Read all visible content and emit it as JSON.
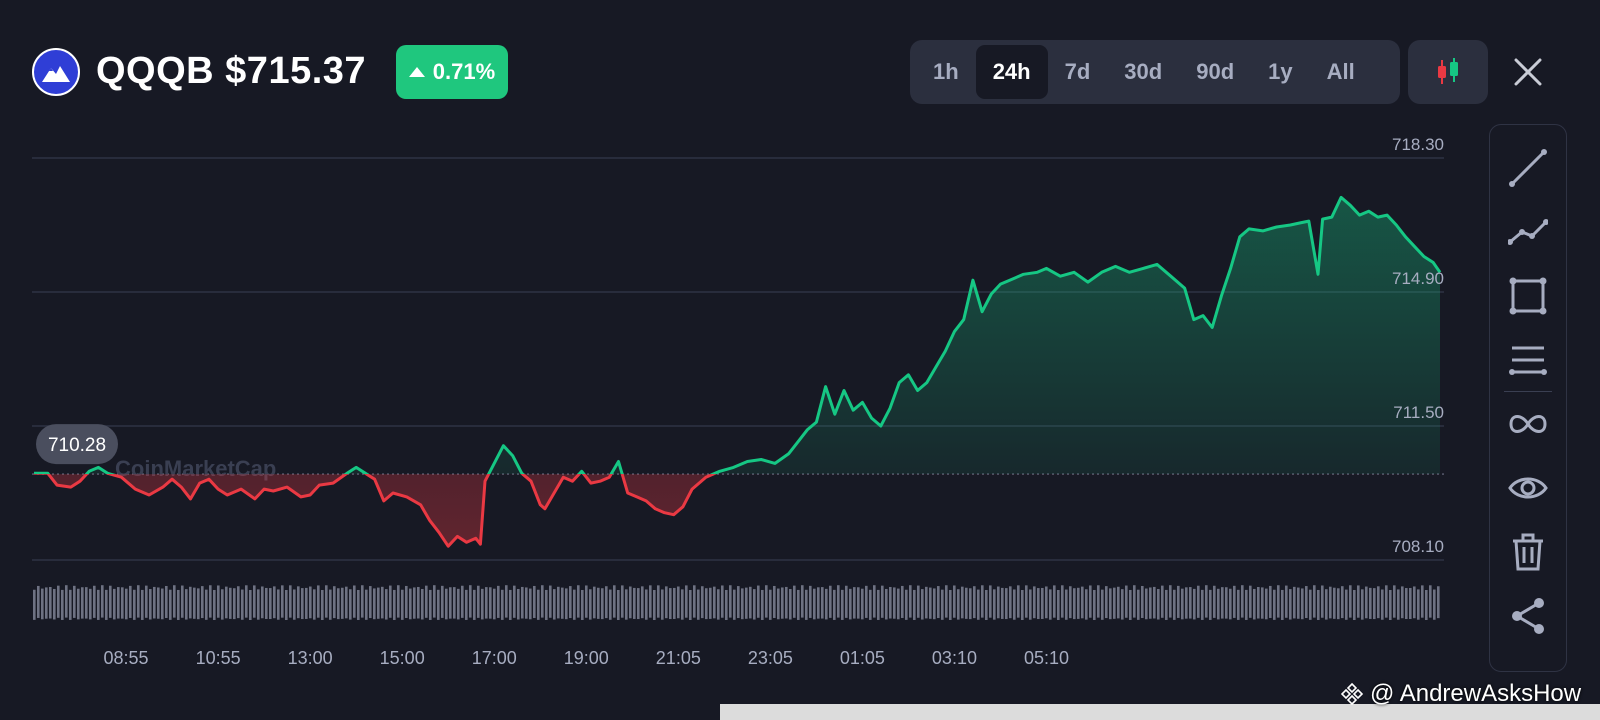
{
  "header": {
    "title": "QQQB $715.37",
    "change": "0.71%",
    "change_direction": "up",
    "logo_icon": "mountain-logo-icon"
  },
  "timeframes": {
    "items": [
      "1h",
      "24h",
      "7d",
      "30d",
      "90d",
      "1y",
      "All"
    ],
    "active": "24h"
  },
  "toolbar": {
    "chart_type_icon": "candlestick-icon",
    "close_icon": "close-icon",
    "tools": [
      "trend-line-icon",
      "path-icon",
      "rectangle-icon",
      "fibonacci-icon",
      "infinite-line-icon",
      "eye-icon",
      "trash-icon",
      "share-icon"
    ]
  },
  "watermark": "CoinMarketCap",
  "credit": "@ AndrewAsksHow",
  "colors": {
    "up": "#16c784",
    "down": "#ea3943",
    "background": "#171924",
    "badge": "#1fc77e"
  },
  "chart_data": {
    "type": "line",
    "title": "",
    "xlabel": "",
    "ylabel": "",
    "baseline_value": 710.28,
    "ylim": [
      707.4,
      719.5
    ],
    "y_ticks": [
      718.3,
      714.9,
      711.5,
      708.1
    ],
    "y_tick_labels": [
      "718.30",
      "714.90",
      "711.50",
      "708.10"
    ],
    "x_tick_labels": [
      "08:55",
      "10:55",
      "13:00",
      "15:00",
      "17:00",
      "19:00",
      "21:05",
      "23:05",
      "01:05",
      "03:10",
      "05:10"
    ],
    "x_range_hours": [
      0,
      24
    ],
    "x_tick_hours": [
      2,
      4,
      6,
      8,
      10,
      12,
      14,
      16,
      18,
      20,
      22
    ],
    "grid": true,
    "series": [
      {
        "points": [
          [
            0.0,
            710.3
          ],
          [
            0.3,
            710.3
          ],
          [
            0.5,
            710.0
          ],
          [
            0.8,
            709.95
          ],
          [
            1.0,
            710.1
          ],
          [
            1.2,
            710.35
          ],
          [
            1.4,
            710.45
          ],
          [
            1.6,
            710.3
          ],
          [
            1.9,
            710.2
          ],
          [
            2.2,
            709.9
          ],
          [
            2.5,
            709.75
          ],
          [
            2.8,
            709.95
          ],
          [
            3.0,
            710.15
          ],
          [
            3.2,
            709.95
          ],
          [
            3.4,
            709.65
          ],
          [
            3.6,
            710.05
          ],
          [
            3.8,
            710.15
          ],
          [
            4.0,
            709.9
          ],
          [
            4.2,
            709.75
          ],
          [
            4.5,
            709.9
          ],
          [
            4.8,
            709.65
          ],
          [
            5.0,
            709.9
          ],
          [
            5.2,
            709.85
          ],
          [
            5.5,
            709.95
          ],
          [
            5.8,
            709.7
          ],
          [
            6.0,
            709.75
          ],
          [
            6.2,
            710.0
          ],
          [
            6.5,
            710.05
          ],
          [
            6.8,
            710.3
          ],
          [
            7.0,
            710.45
          ],
          [
            7.2,
            710.3
          ],
          [
            7.4,
            710.15
          ],
          [
            7.6,
            709.6
          ],
          [
            7.8,
            709.8
          ],
          [
            8.1,
            709.7
          ],
          [
            8.4,
            709.5
          ],
          [
            8.6,
            709.1
          ],
          [
            8.8,
            708.8
          ],
          [
            9.0,
            708.45
          ],
          [
            9.2,
            708.7
          ],
          [
            9.4,
            708.55
          ],
          [
            9.6,
            708.65
          ],
          [
            9.7,
            708.5
          ],
          [
            9.8,
            710.1
          ],
          [
            10.0,
            710.55
          ],
          [
            10.2,
            711.0
          ],
          [
            10.4,
            710.75
          ],
          [
            10.6,
            710.3
          ],
          [
            10.8,
            710.1
          ],
          [
            11.0,
            709.5
          ],
          [
            11.1,
            709.4
          ],
          [
            11.3,
            709.8
          ],
          [
            11.5,
            710.2
          ],
          [
            11.7,
            710.1
          ],
          [
            11.9,
            710.35
          ],
          [
            12.1,
            710.05
          ],
          [
            12.3,
            710.1
          ],
          [
            12.5,
            710.2
          ],
          [
            12.7,
            710.6
          ],
          [
            12.9,
            709.8
          ],
          [
            13.1,
            709.7
          ],
          [
            13.3,
            709.6
          ],
          [
            13.5,
            709.4
          ],
          [
            13.7,
            709.3
          ],
          [
            13.9,
            709.25
          ],
          [
            14.1,
            709.45
          ],
          [
            14.3,
            709.9
          ],
          [
            14.6,
            710.2
          ],
          [
            14.9,
            710.35
          ],
          [
            15.2,
            710.45
          ],
          [
            15.5,
            710.6
          ],
          [
            15.8,
            710.65
          ],
          [
            16.1,
            710.55
          ],
          [
            16.4,
            710.8
          ],
          [
            16.6,
            711.1
          ],
          [
            16.8,
            711.4
          ],
          [
            17.0,
            711.6
          ],
          [
            17.2,
            712.5
          ],
          [
            17.4,
            711.8
          ],
          [
            17.6,
            712.4
          ],
          [
            17.8,
            711.9
          ],
          [
            18.0,
            712.1
          ],
          [
            18.2,
            711.7
          ],
          [
            18.4,
            711.5
          ],
          [
            18.6,
            711.95
          ],
          [
            18.8,
            712.6
          ],
          [
            19.0,
            712.8
          ],
          [
            19.2,
            712.4
          ],
          [
            19.4,
            712.6
          ],
          [
            19.6,
            713.0
          ],
          [
            19.8,
            713.4
          ],
          [
            20.0,
            713.9
          ],
          [
            20.2,
            714.2
          ],
          [
            20.4,
            715.2
          ],
          [
            20.6,
            714.4
          ],
          [
            20.8,
            714.85
          ],
          [
            21.0,
            715.1
          ],
          [
            21.2,
            715.2
          ],
          [
            21.5,
            715.35
          ],
          [
            21.8,
            715.4
          ],
          [
            22.0,
            715.5
          ],
          [
            22.3,
            715.3
          ],
          [
            22.6,
            715.4
          ],
          [
            22.9,
            715.15
          ],
          [
            23.2,
            715.4
          ],
          [
            23.5,
            715.55
          ],
          [
            23.8,
            715.4
          ],
          [
            24.1,
            715.5
          ],
          [
            24.4,
            715.6
          ],
          [
            24.7,
            715.3
          ],
          [
            25.0,
            715.0
          ],
          [
            25.2,
            714.2
          ],
          [
            25.4,
            714.3
          ],
          [
            25.6,
            714.0
          ],
          [
            25.8,
            714.8
          ],
          [
            26.0,
            715.5
          ],
          [
            26.2,
            716.3
          ],
          [
            26.4,
            716.5
          ],
          [
            26.7,
            716.45
          ],
          [
            27.0,
            716.55
          ],
          [
            27.3,
            716.6
          ],
          [
            27.5,
            716.65
          ],
          [
            27.7,
            716.7
          ],
          [
            27.9,
            715.35
          ],
          [
            28.0,
            716.75
          ],
          [
            28.2,
            716.8
          ],
          [
            28.4,
            717.3
          ],
          [
            28.6,
            717.1
          ],
          [
            28.8,
            716.85
          ],
          [
            29.0,
            716.95
          ],
          [
            29.2,
            716.8
          ],
          [
            29.4,
            716.85
          ],
          [
            29.6,
            716.6
          ],
          [
            29.8,
            716.3
          ],
          [
            30.0,
            716.05
          ],
          [
            30.2,
            715.8
          ],
          [
            30.4,
            715.65
          ],
          [
            30.55,
            715.4
          ]
        ]
      }
    ],
    "last_value": 715.37,
    "volume_note": "volume strip shown as uniform grey bars beneath price"
  }
}
